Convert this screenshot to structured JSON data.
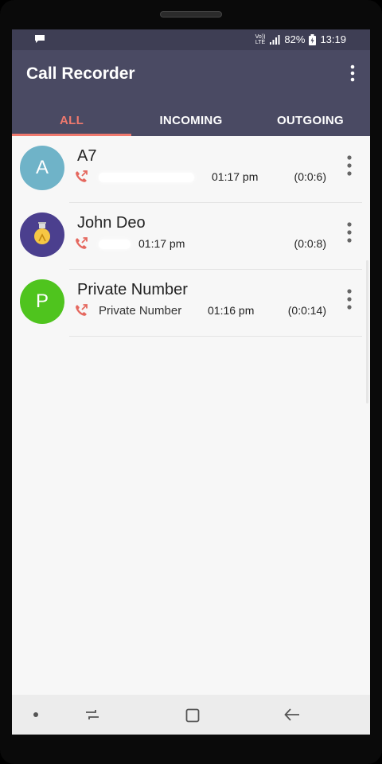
{
  "status": {
    "volte_line1": "Vo))",
    "volte_line2": "LTE",
    "battery": "82%",
    "clock": "13:19"
  },
  "app": {
    "title": "Call Recorder"
  },
  "tabs": [
    {
      "label": "ALL",
      "active": true
    },
    {
      "label": "INCOMING",
      "active": false
    },
    {
      "label": "OUTGOING",
      "active": false
    }
  ],
  "calls": [
    {
      "initial": "A",
      "avatar_color": "#6fb3c8",
      "name": "A7",
      "number": "",
      "time": "01:17 pm",
      "duration": "(0:0:6)"
    },
    {
      "initial": "",
      "avatar_color": "#4b3f8e",
      "name": "John Deo",
      "number": "",
      "time": "01:17 pm",
      "duration": "(0:0:8)"
    },
    {
      "initial": "P",
      "avatar_color": "#4fc41e",
      "name": "Private Number",
      "number": "Private Number",
      "time": "01:16 pm",
      "duration": "(0:0:14)"
    }
  ],
  "colors": {
    "accent": "#f0796e",
    "appbar": "#4a4a63",
    "statusbar": "#3e3e54"
  }
}
